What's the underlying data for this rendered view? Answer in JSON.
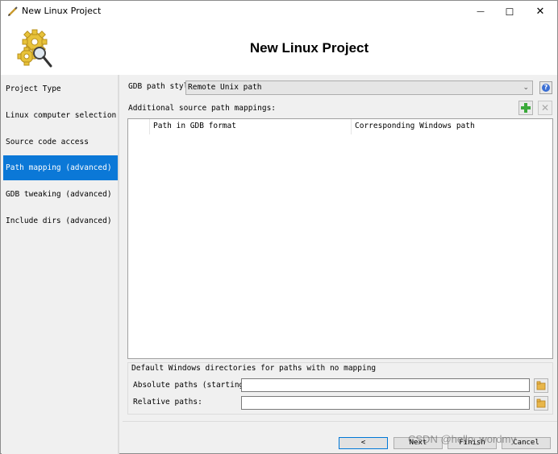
{
  "window": {
    "title": "New Linux Project",
    "minimize_symbol": "—",
    "maximize_symbol": "☐",
    "close_symbol": "✕"
  },
  "header": {
    "title": "New Linux Project",
    "icon": "gear-key-icon"
  },
  "nav": {
    "items": [
      {
        "label": "Project Type",
        "active": false
      },
      {
        "label": "Linux computer selection",
        "active": false
      },
      {
        "label": "Source code access",
        "active": false
      },
      {
        "label": "Path mapping (advanced)",
        "active": true
      },
      {
        "label": "GDB tweaking (advanced)",
        "active": false
      },
      {
        "label": "Include dirs (advanced)",
        "active": false
      }
    ]
  },
  "path_mapping": {
    "gdb_path_style_label": "GDB path styl",
    "gdb_path_style_value": "Remote Unix path",
    "help_symbol": "?",
    "mappings_label": "Additional source path mappings:",
    "table": {
      "columns": [
        "",
        "Path in GDB format",
        "Corresponding Windows path"
      ],
      "rows": []
    },
    "defaults": {
      "title": "Default Windows directories for paths with no mapping",
      "absolute_label": "Absolute paths (starting",
      "absolute_value": "",
      "relative_label": "Relative paths:",
      "relative_value": ""
    }
  },
  "buttons": {
    "back": "<",
    "next": "Next",
    "finish": "Finish",
    "cancel": "Cancel"
  },
  "watermark": "CSDN @hello_wordmy",
  "colors": {
    "accent": "#0b78d7",
    "add_icon": "#3aa93a",
    "folder_icon": "#e8b64a"
  }
}
